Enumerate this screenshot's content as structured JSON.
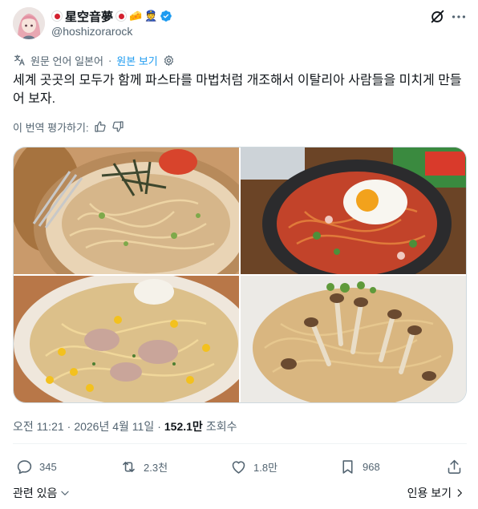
{
  "author": {
    "display_name": "星空音夢",
    "handle": "@hoshizorarock",
    "badge_emoji_1": "🧀",
    "badge_emoji_2": "👮"
  },
  "translation": {
    "source_language": "원문 언어 일본어",
    "view_original": "원본 보기"
  },
  "tweet": {
    "text": "세계 곳곳의 모두가 함께 파스타를 마법처럼 개조해서 이탈리아 사람들을 미치게 만들어 보자."
  },
  "rate": {
    "label": "이 번역 평가하기:"
  },
  "meta": {
    "time": "오전 11:21",
    "date": "2026년 4월 11일",
    "views_count": "152.1만",
    "views_label": "조회수"
  },
  "actions": {
    "replies": "345",
    "reposts": "2.3천",
    "likes": "1.8만",
    "bookmarks": "968"
  },
  "footer": {
    "related": "관련 있음",
    "quotes": "인용 보기"
  },
  "colors": {
    "accent": "#1d9bf0",
    "text": "#0f1419",
    "muted": "#536471"
  }
}
